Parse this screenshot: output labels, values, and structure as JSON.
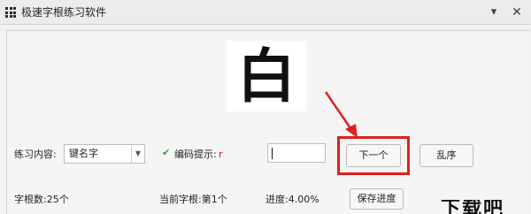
{
  "window": {
    "title": "极速字根练习软件",
    "minimize_glyph": "▾",
    "close_glyph": "✕"
  },
  "practice": {
    "character": "白",
    "content_label": "练习内容:",
    "content_value": "键名字",
    "hint_label": "编码提示:",
    "hint_value": "r",
    "hint_checked": true,
    "input_value": ""
  },
  "buttons": {
    "next": "下一个",
    "shuffle": "乱序",
    "save": "保存进度"
  },
  "status": {
    "count": "字根数:25个",
    "current": "当前字根:第1个",
    "progress": "进度:4.00%"
  },
  "annotations": {
    "highlight_color": "#e01f1f"
  },
  "watermark": "下载吧"
}
